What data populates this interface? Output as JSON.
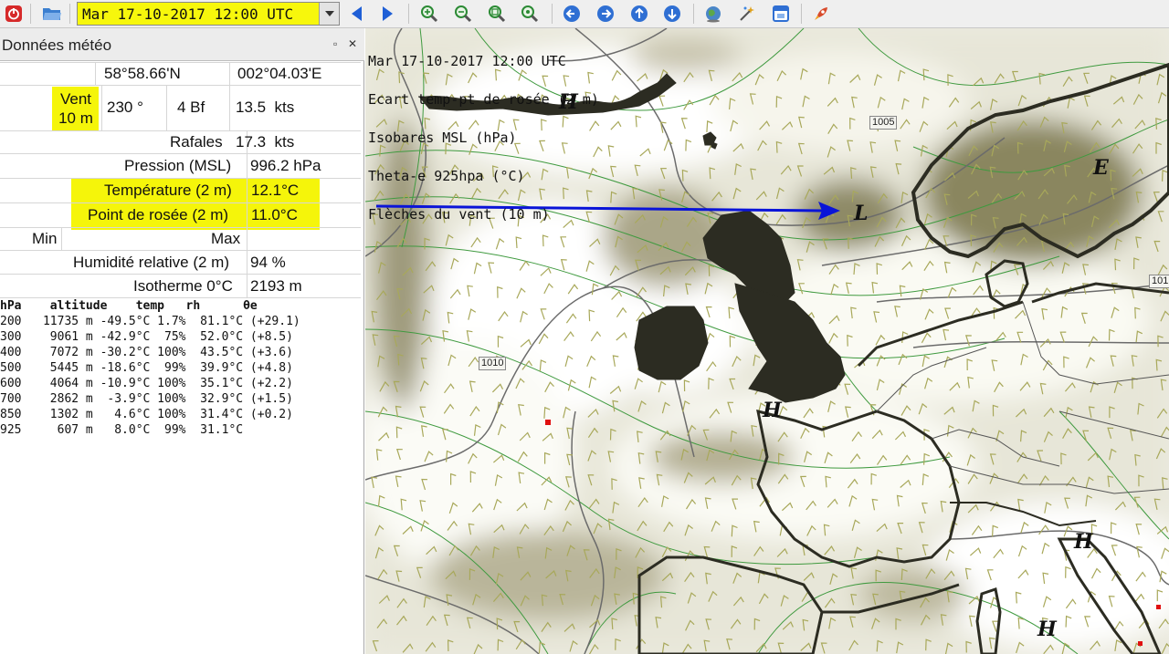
{
  "toolbar": {
    "date_value": "Mar 17-10-2017 12:00 UTC",
    "buttons": [
      {
        "name": "quit-button",
        "icon": "power-icon"
      },
      {
        "name": "open-file-button",
        "icon": "folder-icon"
      },
      {
        "name": "previous-date-button",
        "icon": "triangle-left-icon"
      },
      {
        "name": "next-date-button",
        "icon": "triangle-right-icon"
      },
      {
        "name": "zoom-in-button",
        "icon": "zoom-in-icon"
      },
      {
        "name": "zoom-out-button",
        "icon": "zoom-out-icon"
      },
      {
        "name": "zoom-best-fit-button",
        "icon": "zoom-fit-icon"
      },
      {
        "name": "zoom-selection-button",
        "icon": "zoom-selection-icon"
      },
      {
        "name": "pan-left-button",
        "icon": "arrow-left-circle-icon"
      },
      {
        "name": "pan-right-button",
        "icon": "arrow-right-circle-icon"
      },
      {
        "name": "pan-up-button",
        "icon": "arrow-up-circle-icon"
      },
      {
        "name": "pan-down-button",
        "icon": "arrow-down-circle-icon"
      },
      {
        "name": "globe-projection-button",
        "icon": "globe-icon"
      },
      {
        "name": "animation-button",
        "icon": "wand-icon"
      },
      {
        "name": "overlay-button",
        "icon": "window-icon"
      },
      {
        "name": "boat-route-button",
        "icon": "rocket-icon"
      }
    ]
  },
  "panel": {
    "title": "Données météo",
    "float_glyph": "▫",
    "close_glyph": "✕",
    "latitude": "58°58.66'N",
    "longitude": "002°04.03'E",
    "wind_label_line1": "Vent",
    "wind_label_line2": "10 m",
    "wind_direction": "230 °",
    "wind_beaufort": "4 Bf",
    "wind_speed": "13.5  kts",
    "gusts_label": "Rafales",
    "gusts_value": "17.3  kts",
    "pressure_label": "Pression (MSL)",
    "pressure_value": "996.2 hPa",
    "temperature_label": "Température (2 m)",
    "temperature_value": "12.1°C",
    "dewpoint_label": "Point de rosée (2 m)",
    "dewpoint_value": "11.0°C",
    "min_label": "Min",
    "max_label": "Max",
    "humidity_label": "Humidité relative (2 m)",
    "humidity_value": "94 %",
    "isotherm_label": "Isotherme 0°C",
    "isotherm_value": "2193 m",
    "levels_header": "hPa    altitude    temp   rh      θe",
    "levels": [
      "200   11735 m -49.5°C 1.7%  81.1°C (+29.1)",
      "300    9061 m -42.9°C  75%  52.0°C (+8.5)",
      "400    7072 m -30.2°C 100%  43.5°C (+3.6)",
      "500    5445 m -18.6°C  99%  39.9°C (+4.8)",
      "600    4064 m -10.9°C 100%  35.1°C (+2.2)",
      "700    2862 m  -3.9°C 100%  32.9°C (+1.5)",
      "850    1302 m   4.6°C 100%  31.4°C (+0.2)",
      "925     607 m   8.0°C  99%  31.1°C"
    ]
  },
  "map": {
    "title_lines": [
      "Mar 17-10-2017 12:00 UTC",
      "Ecart temp-pt de rosée (2 m)",
      "Isobares MSL (hPa)",
      "Theta-e 925hpa (°C)",
      "Flèches du vent (10 m)"
    ],
    "pressure_letters": [
      "H",
      "L",
      "E",
      "H",
      "H",
      "H"
    ],
    "isobar_labels": [
      "1005",
      "1010",
      "101"
    ],
    "annotation_arrow_color": "#0a14d8",
    "highlight_color": "#f5f50a",
    "isobar_color": "#6b6b6b",
    "theta_e_color": "#3f9a3f",
    "wind_barb_color": "#a8a85a",
    "coast_color": "#2c2c22"
  }
}
